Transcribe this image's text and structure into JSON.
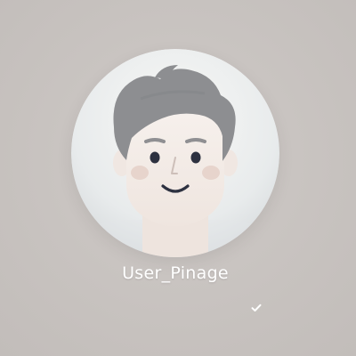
{
  "profile": {
    "username": "User_Pinage",
    "avatar_icon": "user-avatar-icon",
    "status_icon": "checkmark-icon"
  },
  "colors": {
    "background": "#c9c4c1",
    "avatar_circle_light": "#f6f6f4",
    "avatar_circle_shade": "#d8dcdf",
    "hair": "#8c8d90",
    "skin": "#f3ece7",
    "cheeks": "#e7d6cf",
    "text": "#ffffff"
  }
}
